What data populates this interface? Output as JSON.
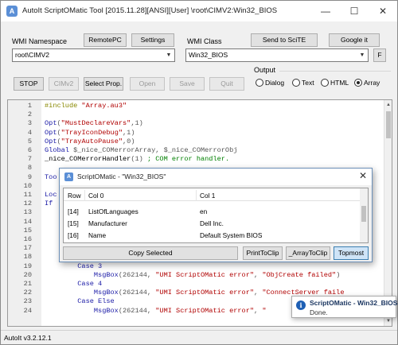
{
  "window": {
    "title": "AutoIt ScriptOMatic Tool  [2015.11.28][ANSI][User] \\root\\CIMV2:Win32_BIOS",
    "app_icon": "autoit-icon"
  },
  "top_controls": {
    "wmi_namespace_label": "WMI Namespace",
    "remotepc_label": "RemotePC",
    "settings_label": "Settings",
    "wmi_class_label": "WMI Class",
    "send_to_scite_label": "Send to SciTE",
    "google_it_label": "Google it",
    "namespace_value": "root\\CIMV2",
    "class_value": "Win32_BIOS",
    "f_label": "F"
  },
  "action_buttons": {
    "stop": "STOP",
    "cimv2": "CIMv2",
    "select_prop": "Select Prop.",
    "open": "Open",
    "save": "Save",
    "quit": "Quit"
  },
  "output": {
    "label": "Output",
    "options": [
      "Dialog",
      "Text",
      "HTML",
      "Array"
    ],
    "selected": "Array"
  },
  "editor": {
    "lines": [
      {
        "n": "1",
        "segments": [
          {
            "t": "#include ",
            "c": "#888800"
          },
          {
            "t": "\"Array.au3\"",
            "c": "#b00000"
          }
        ]
      },
      {
        "n": "2",
        "segments": []
      },
      {
        "n": "3",
        "segments": [
          {
            "t": "Opt",
            "c": "#1a1aa6"
          },
          {
            "t": "(",
            "c": "#555"
          },
          {
            "t": "\"MustDeclareVars\"",
            "c": "#b00000"
          },
          {
            "t": ",1)",
            "c": "#555"
          }
        ]
      },
      {
        "n": "4",
        "segments": [
          {
            "t": "Opt",
            "c": "#1a1aa6"
          },
          {
            "t": "(",
            "c": "#555"
          },
          {
            "t": "\"TrayIconDebug\"",
            "c": "#b00000"
          },
          {
            "t": ",1)",
            "c": "#555"
          }
        ]
      },
      {
        "n": "5",
        "segments": [
          {
            "t": "Opt",
            "c": "#1a1aa6"
          },
          {
            "t": "(",
            "c": "#555"
          },
          {
            "t": "\"TrayAutoPause\"",
            "c": "#b00000"
          },
          {
            "t": ",0)",
            "c": "#555"
          }
        ]
      },
      {
        "n": "6",
        "segments": [
          {
            "t": "Global ",
            "c": "#1a1aa6"
          },
          {
            "t": "$_nice_COMerrorArray, $_nice_COMerrorObj",
            "c": "#555"
          }
        ]
      },
      {
        "n": "7",
        "segments": [
          {
            "t": "_nice_COMerrorHandler",
            "c": "#000"
          },
          {
            "t": "(1) ",
            "c": "#555"
          },
          {
            "t": "; COM error handler.",
            "c": "#008000"
          }
        ]
      },
      {
        "n": "8",
        "segments": []
      },
      {
        "n": "9",
        "segments": [
          {
            "t": "Too",
            "c": "#1a1aa6"
          }
        ]
      },
      {
        "n": "10",
        "segments": []
      },
      {
        "n": "11",
        "segments": [
          {
            "t": "Loc",
            "c": "#1a1aa6"
          }
        ]
      },
      {
        "n": "12",
        "segments": [
          {
            "t": "If",
            "c": "#1a1aa6"
          }
        ]
      },
      {
        "n": "13",
        "segments": []
      },
      {
        "n": "14",
        "segments": []
      },
      {
        "n": "15",
        "segments": []
      },
      {
        "n": "16",
        "segments": []
      },
      {
        "n": "17",
        "segments": []
      },
      {
        "n": "18",
        "segments": []
      },
      {
        "n": "19",
        "segments": [
          {
            "t": "        Case 3",
            "c": "#1a1aa6"
          }
        ]
      },
      {
        "n": "20",
        "segments": [
          {
            "t": "            MsgBox",
            "c": "#1a1aa6"
          },
          {
            "t": "(262144, ",
            "c": "#555"
          },
          {
            "t": "\"UMI ScriptOMatic error\"",
            "c": "#b00000"
          },
          {
            "t": ", ",
            "c": "#555"
          },
          {
            "t": "\"ObjCreate failed\"",
            "c": "#b00000"
          },
          {
            "t": ")",
            "c": "#555"
          }
        ]
      },
      {
        "n": "21",
        "segments": [
          {
            "t": "        Case 4",
            "c": "#1a1aa6"
          }
        ]
      },
      {
        "n": "22",
        "segments": [
          {
            "t": "            MsgBox",
            "c": "#1a1aa6"
          },
          {
            "t": "(262144, ",
            "c": "#555"
          },
          {
            "t": "\"UMI ScriptOMatic error\"",
            "c": "#b00000"
          },
          {
            "t": ", ",
            "c": "#555"
          },
          {
            "t": "\"ConnectServer faile",
            "c": "#b00000"
          }
        ]
      },
      {
        "n": "23",
        "segments": [
          {
            "t": "        Case Else",
            "c": "#1a1aa6"
          }
        ]
      },
      {
        "n": "24",
        "segments": [
          {
            "t": "            MsgBox",
            "c": "#1a1aa6"
          },
          {
            "t": "(262144, ",
            "c": "#555"
          },
          {
            "t": "\"UMI ScriptOMatic error\"",
            "c": "#b00000"
          },
          {
            "t": ", ",
            "c": "#555"
          },
          {
            "t": "\"",
            "c": "#b00000"
          }
        ]
      }
    ]
  },
  "status_bar": {
    "text": "AutoIt v3.2.12.1"
  },
  "array_dialog": {
    "title": "ScriptOMatic - \"Win32_BIOS\"",
    "columns": [
      "Row",
      "Col 0",
      "Col 1"
    ],
    "rows": [
      [
        "[14]",
        "ListOfLanguages",
        "en"
      ],
      [
        "[15]",
        "Manufacturer",
        "Dell Inc."
      ],
      [
        "[16]",
        "Name",
        "Default System BIOS"
      ]
    ],
    "copy_selected": "Copy Selected",
    "print_to_clip": "PrintToClip",
    "array_to_clip": "_ArrayToClip",
    "topmost": "Topmost"
  },
  "notification": {
    "title": "ScriptOMatic - Win32_BIOS",
    "message": "Done."
  }
}
